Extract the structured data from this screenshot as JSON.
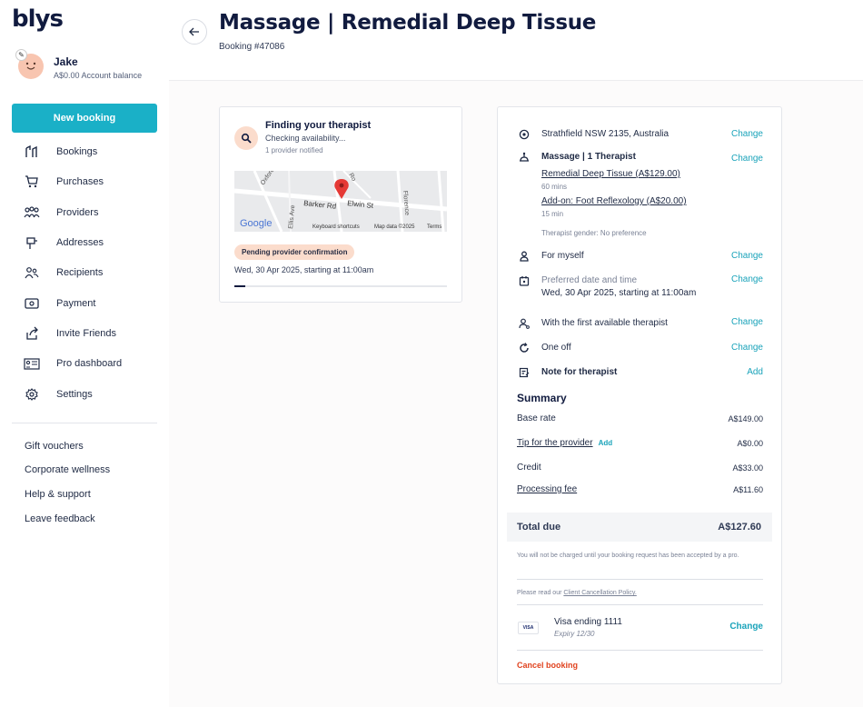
{
  "brand": {
    "logo": "blys"
  },
  "user": {
    "name": "Jake",
    "balance": "A$0.00 Account balance"
  },
  "sidebar": {
    "new_booking": "New booking",
    "items": [
      {
        "label": "Bookings",
        "icon": "bookings-icon"
      },
      {
        "label": "Purchases",
        "icon": "cart-icon"
      },
      {
        "label": "Providers",
        "icon": "providers-icon"
      },
      {
        "label": "Addresses",
        "icon": "address-icon"
      },
      {
        "label": "Recipients",
        "icon": "recipients-icon"
      },
      {
        "label": "Payment",
        "icon": "payment-icon"
      },
      {
        "label": "Invite Friends",
        "icon": "share-icon"
      },
      {
        "label": "Pro dashboard",
        "icon": "pro-dashboard-icon"
      },
      {
        "label": "Settings",
        "icon": "gear-icon"
      }
    ],
    "footer_links": [
      "Gift vouchers",
      "Corporate wellness",
      "Help & support",
      "Leave feedback"
    ]
  },
  "header": {
    "title": "Massage | Remedial Deep Tissue",
    "booking_number": "Booking #47086"
  },
  "finding": {
    "title": "Finding your therapist",
    "subtitle": "Checking availability...",
    "notified": "1 provider notified",
    "map": {
      "roads": [
        "Barker Rd",
        "Elwin St",
        "Oxford",
        "Florence",
        "Ellis Ave",
        "Ro"
      ],
      "google": "Google",
      "shortcuts": "Keyboard shortcuts",
      "map_data": "Map data ©2025",
      "terms": "Terms"
    },
    "status": "Pending provider confirmation",
    "date": "Wed, 30 Apr 2025, starting at 11:00am",
    "progress": 0.05
  },
  "details": {
    "address": {
      "text": "Strathfield NSW 2135, Australia",
      "action": "Change"
    },
    "service": {
      "title": "Massage | 1 Therapist",
      "action": "Change",
      "treatment": "Remedial Deep Tissue (A$129.00)",
      "treatment_duration": "60 mins",
      "addon": "Add-on: Foot Reflexology (A$20.00)",
      "addon_duration": "15 min",
      "gender": "Therapist gender: No preference"
    },
    "recipient": {
      "text": "For myself",
      "action": "Change"
    },
    "datetime": {
      "label": "Preferred date and time",
      "value": "Wed, 30 Apr 2025, starting at 11:00am",
      "action": "Change"
    },
    "therapist": {
      "text": "With the first available therapist",
      "action": "Change"
    },
    "frequency": {
      "text": "One off",
      "action": "Change"
    },
    "note": {
      "text": "Note for therapist",
      "action": "Add"
    }
  },
  "summary": {
    "title": "Summary",
    "base_rate": {
      "label": "Base rate",
      "value": "A$149.00"
    },
    "tip": {
      "label": "Tip for the provider",
      "action": "Add",
      "value": "A$0.00"
    },
    "credit": {
      "label": "Credit",
      "value": "A$33.00"
    },
    "processing": {
      "label": "Processing fee",
      "value": "A$11.60"
    },
    "total": {
      "label": "Total due",
      "value": "A$127.60"
    },
    "charge_note": "You will not be charged until your booking request has been accepted by a pro.",
    "policy_prefix": "Please read our ",
    "policy_link": "Client Cancellation Policy."
  },
  "payment": {
    "brand": "VISA",
    "card": "Visa ending 1111",
    "expiry": "Expiry 12/30",
    "action": "Change"
  },
  "cancel": "Cancel booking",
  "colors": {
    "accent": "#1ab0c7",
    "link": "#1aa3ba",
    "navy": "#111b3f",
    "danger": "#e0431f",
    "badge": "#fbdccc"
  }
}
